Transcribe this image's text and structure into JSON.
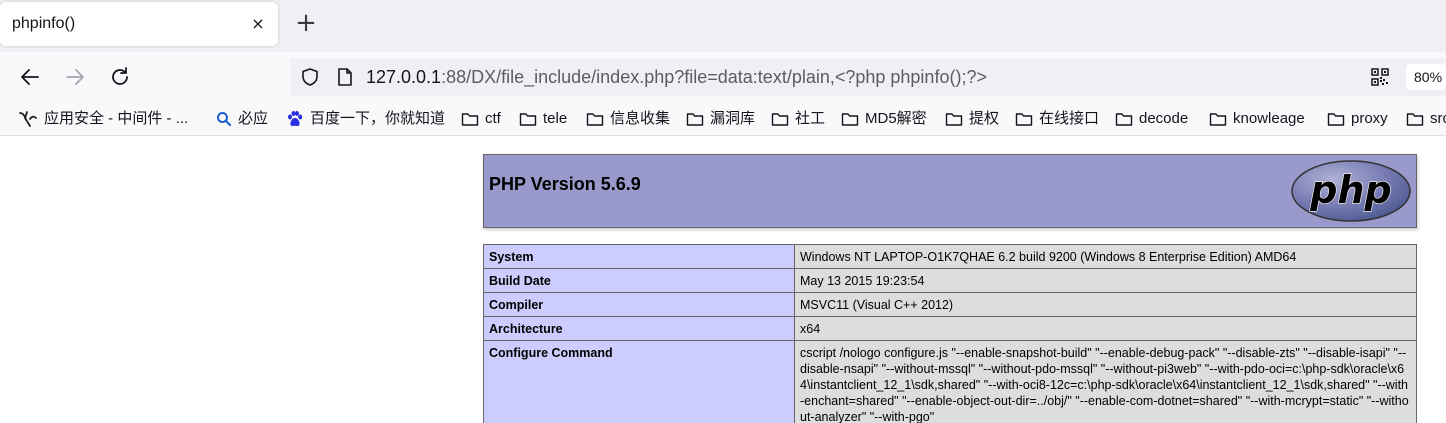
{
  "tab": {
    "title": "phpinfo()",
    "close": "×",
    "new_tab": "+"
  },
  "nav": {
    "back_icon": "arrow-left-icon",
    "forward_icon": "arrow-right-icon",
    "reload_icon": "reload-icon",
    "url_host": "127.0.0.1",
    "url_rest": ":88/DX/file_include/index.php?file=data:text/plain,<?php phpinfo();?>",
    "zoom": "80%"
  },
  "bookmarks": [
    {
      "label": "应用安全 - 中间件 - ...",
      "icon": "app-security-icon"
    },
    {
      "label": "必应",
      "icon": "bing-search-icon"
    },
    {
      "label": "百度一下，你就知道",
      "icon": "baidu-paw-icon"
    },
    {
      "label": "ctf",
      "icon": "folder-icon"
    },
    {
      "label": "tele",
      "icon": "folder-icon"
    },
    {
      "label": "信息收集",
      "icon": "folder-icon"
    },
    {
      "label": "漏洞库",
      "icon": "folder-icon"
    },
    {
      "label": "社工",
      "icon": "folder-icon"
    },
    {
      "label": "MD5解密",
      "icon": "folder-icon"
    },
    {
      "label": "提权",
      "icon": "folder-icon"
    },
    {
      "label": "在线接口",
      "icon": "folder-icon"
    },
    {
      "label": "decode",
      "icon": "folder-icon"
    },
    {
      "label": "knowleage",
      "icon": "folder-icon"
    },
    {
      "label": "proxy",
      "icon": "folder-icon"
    },
    {
      "label": "src",
      "icon": "folder-icon"
    }
  ],
  "php": {
    "title": "PHP Version 5.6.9",
    "logo_text": "php",
    "rows": [
      {
        "key": "System",
        "value": "Windows NT LAPTOP-O1K7QHAE 6.2 build 9200 (Windows 8 Enterprise Edition) AMD64"
      },
      {
        "key": "Build Date",
        "value": "May 13 2015 19:23:54"
      },
      {
        "key": "Compiler",
        "value": "MSVC11 (Visual C++ 2012)"
      },
      {
        "key": "Architecture",
        "value": "x64"
      },
      {
        "key": "Configure Command",
        "value": "cscript /nologo configure.js \"--enable-snapshot-build\" \"--enable-debug-pack\" \"--disable-zts\" \"--disable-isapi\" \"--disable-nsapi\" \"--without-mssql\" \"--without-pdo-mssql\" \"--without-pi3web\" \"--with-pdo-oci=c:\\php-sdk\\oracle\\x64\\instantclient_12_1\\sdk,shared\" \"--with-oci8-12c=c:\\php-sdk\\oracle\\x64\\instantclient_12_1\\sdk,shared\" \"--with-enchant=shared\" \"--enable-object-out-dir=../obj/\" \"--enable-com-dotnet=shared\" \"--with-mcrypt=static\" \"--without-analyzer\" \"--with-pgo\""
      }
    ]
  },
  "colors": {
    "php_header_bg": "#9999cc",
    "key_cell_bg": "#ccccff",
    "value_cell_bg": "#dddddd"
  }
}
